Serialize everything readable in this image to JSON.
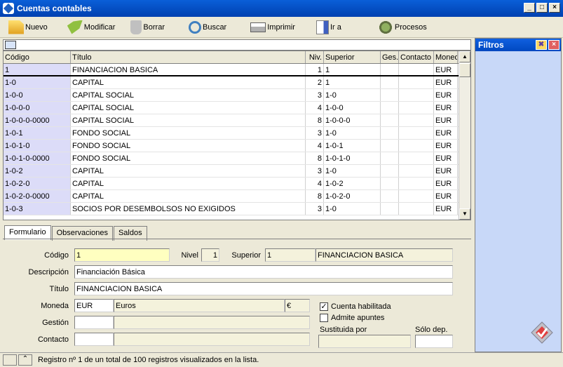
{
  "window": {
    "title": "Cuentas contables"
  },
  "toolbar": {
    "nuevo": "Nuevo",
    "modificar": "Modificar",
    "borrar": "Borrar",
    "buscar": "Buscar",
    "imprimir": "Imprimir",
    "ira": "Ir a",
    "procesos": "Procesos"
  },
  "grid": {
    "headers": [
      "Código",
      "Título",
      "Niv.",
      "Superior",
      "Ges.",
      "Contacto",
      "Moneda"
    ],
    "rows": [
      [
        "1",
        "FINANCIACION BASICA",
        "1",
        "1",
        "",
        "",
        "EUR"
      ],
      [
        "1-0",
        "CAPITAL",
        "2",
        "1",
        "",
        "",
        "EUR"
      ],
      [
        "1-0-0",
        "CAPITAL SOCIAL",
        "3",
        "1-0",
        "",
        "",
        "EUR"
      ],
      [
        "1-0-0-0",
        "CAPITAL SOCIAL",
        "4",
        "1-0-0",
        "",
        "",
        "EUR"
      ],
      [
        "1-0-0-0-0000",
        "CAPITAL SOCIAL",
        "8",
        "1-0-0-0",
        "",
        "",
        "EUR"
      ],
      [
        "1-0-1",
        "FONDO SOCIAL",
        "3",
        "1-0",
        "",
        "",
        "EUR"
      ],
      [
        "1-0-1-0",
        "FONDO SOCIAL",
        "4",
        "1-0-1",
        "",
        "",
        "EUR"
      ],
      [
        "1-0-1-0-0000",
        "FONDO SOCIAL",
        "8",
        "1-0-1-0",
        "",
        "",
        "EUR"
      ],
      [
        "1-0-2",
        "CAPITAL",
        "3",
        "1-0",
        "",
        "",
        "EUR"
      ],
      [
        "1-0-2-0",
        "CAPITAL",
        "4",
        "1-0-2",
        "",
        "",
        "EUR"
      ],
      [
        "1-0-2-0-0000",
        "CAPITAL",
        "8",
        "1-0-2-0",
        "",
        "",
        "EUR"
      ],
      [
        "1-0-3",
        "SOCIOS POR DESEMBOLSOS NO EXIGIDOS",
        "3",
        "1-0",
        "",
        "",
        "EUR"
      ]
    ]
  },
  "tabs": [
    "Formulario",
    "Observaciones",
    "Saldos"
  ],
  "form": {
    "codigo_label": "Código",
    "codigo": "1",
    "nivel_label": "Nivel",
    "nivel": "1",
    "superior_label": "Superior",
    "superior": "1",
    "superior_desc": "FINANCIACION BASICA",
    "descripcion_label": "Descripción",
    "descripcion": "Financiación Básica",
    "titulo_label": "Título",
    "titulo": "FINANCIACION BASICA",
    "moneda_label": "Moneda",
    "moneda": "EUR",
    "moneda_desc": "Euros",
    "moneda_symbol": "€",
    "gestion_label": "Gestión",
    "contacto_label": "Contacto",
    "cuenta_habilitada": "Cuenta habilitada",
    "admite_apuntes": "Admite apuntes",
    "sustituida_label": "Sustituida por",
    "solo_dep_label": "Sólo dep."
  },
  "filters": {
    "title": "Filtros"
  },
  "status": {
    "text": "Registro nº 1 de un total de 100 registros visualizados en la lista."
  }
}
